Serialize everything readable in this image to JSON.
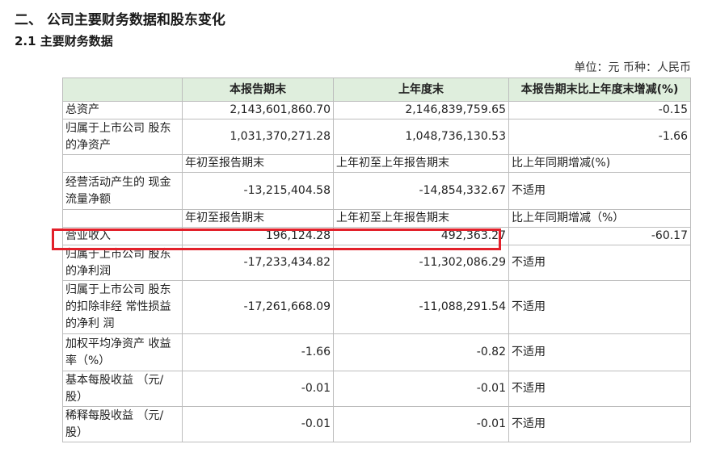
{
  "section_title": "二、 公司主要财务数据和股东变化",
  "subsection_title": "2.1 主要财务数据",
  "unit_line": "单位：元 币种：人民币",
  "header": {
    "col1": "",
    "col2": "本报告期末",
    "col3": "上年度末",
    "col4": "本报告期末比上年度末增减(%)"
  },
  "rows_a": [
    {
      "label": "总资产",
      "c2": "2,143,601,860.70",
      "c3": "2,146,839,759.65",
      "c4": "-0.15"
    },
    {
      "label": "归属于上市公司 股东的净资产",
      "c2": "1,031,370,271.28",
      "c3": "1,048,736,130.53",
      "c4": "-1.66"
    }
  ],
  "subheader_1": {
    "c2": "年初至报告期末",
    "c3": "上年初至上年报告期末",
    "c4": "比上年同期增减(%)"
  },
  "rows_b": [
    {
      "label": "经营活动产生的 现金流量净额",
      "c2": "-13,215,404.58",
      "c3": "-14,854,332.67",
      "c4": "不适用"
    }
  ],
  "subheader_2": {
    "c2": "年初至报告期末",
    "c3": "上年初至上年报告期末",
    "c4": "比上年同期增减（%）"
  },
  "rows_c": [
    {
      "label": "营业收入",
      "c2": "196,124.28",
      "c3": "492,363.27",
      "c4": "-60.17"
    },
    {
      "label": "归属于上市公司 股东的净利润",
      "c2": "-17,233,434.82",
      "c3": "-11,302,086.29",
      "c4": "不适用"
    },
    {
      "label": "归属于上市公司 股东的扣除非经 常性损益的净利 润",
      "c2": "-17,261,668.09",
      "c3": "-11,088,291.54",
      "c4": "不适用"
    },
    {
      "label": "加权平均净资产 收益率（%）",
      "c2": "-1.66",
      "c3": "-0.82",
      "c4": "不适用"
    },
    {
      "label": "基本每股收益 （元/股）",
      "c2": "-0.01",
      "c3": "-0.01",
      "c4": "不适用"
    },
    {
      "label": "稀释每股收益 （元/股）",
      "c2": "-0.01",
      "c3": "-0.01",
      "c4": "不适用"
    }
  ]
}
